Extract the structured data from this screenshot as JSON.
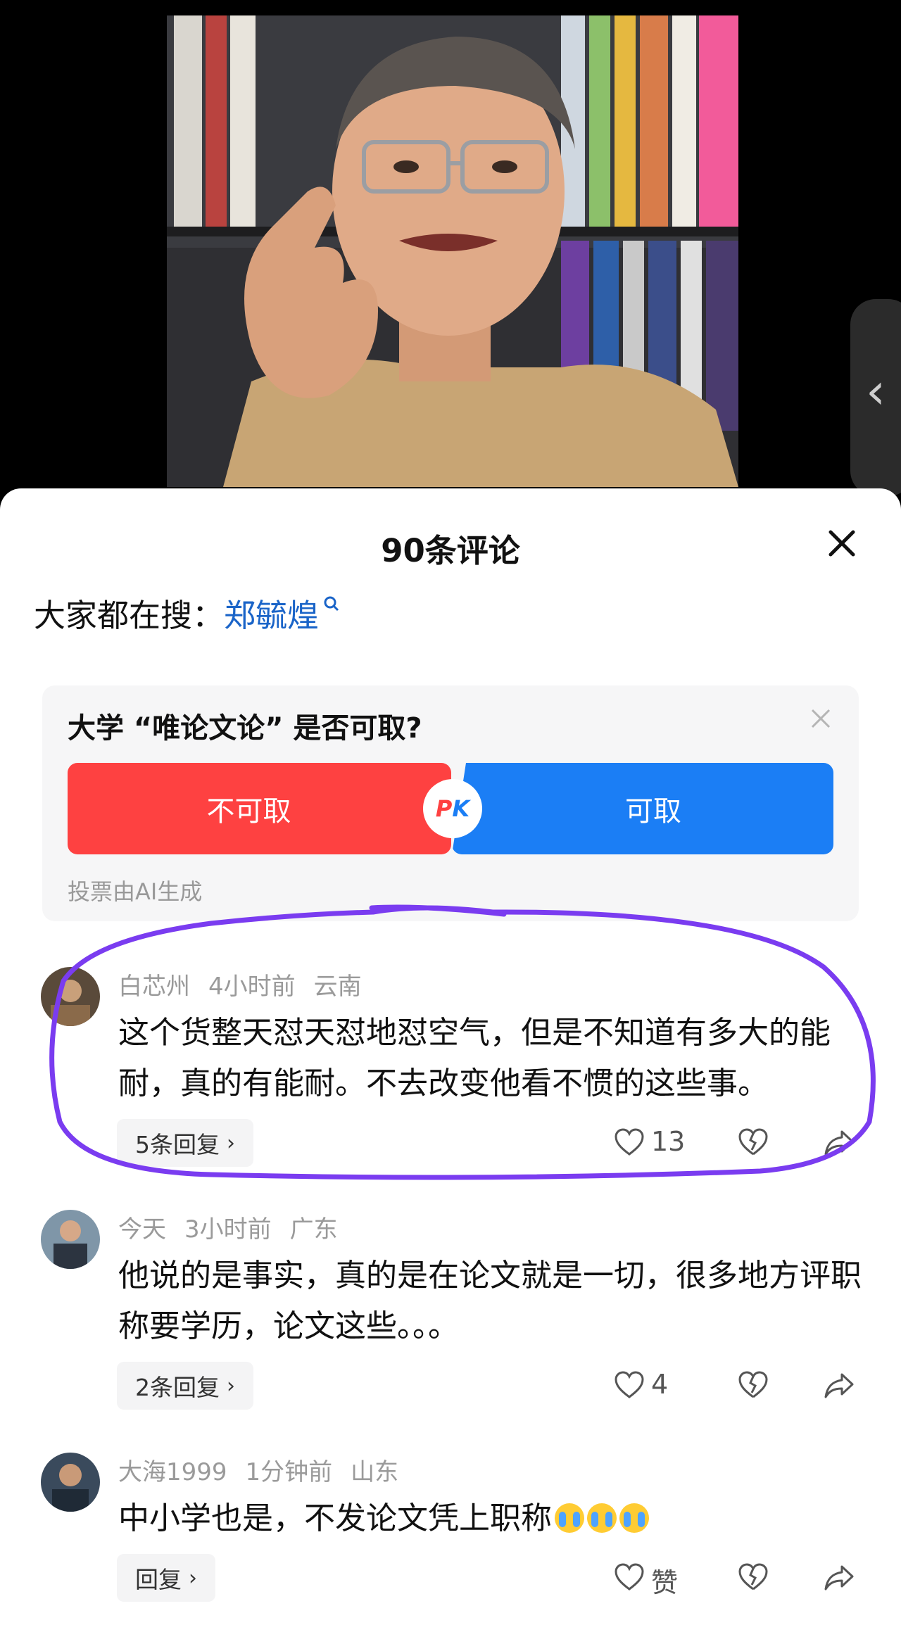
{
  "header": {
    "title": "90条评论"
  },
  "search": {
    "prefix": "大家都在搜：",
    "term": "郑毓煌"
  },
  "poll": {
    "question": "大学 “唯论文论” 是否可取?",
    "option_no": "不可取",
    "option_yes": "可取",
    "pk_p": "P",
    "pk_k": "K",
    "note": "投票由AI生成"
  },
  "comments": [
    {
      "user": "白芯州",
      "time": "4小时前",
      "location": "云南",
      "text": "这个货整天怼天怼地怼空气，但是不知道有多大的能耐，真的有能耐。不去改变他看不惯的这些事。",
      "replies": "5条回复",
      "likes": "13"
    },
    {
      "user": "今天",
      "time": "3小时前",
      "location": "广东",
      "text": "他说的是事实，真的是在论文就是一切，很多地方评职称要学历，论文这些。。。",
      "replies": "2条回复",
      "likes": "4"
    },
    {
      "user": "大海1999",
      "time": "1分钟前",
      "location": "山东",
      "text": "中小学也是，不发论文凭上职称",
      "replies": "回复",
      "likes": "赞"
    }
  ],
  "icons": {
    "close": "close-icon",
    "search": "search-icon",
    "like": "heart-icon",
    "dislike": "broken-heart-icon",
    "share": "share-icon",
    "back": "chevron-left-icon"
  },
  "colors": {
    "accent_red": "#fe4141",
    "accent_blue": "#1b7ef5",
    "link": "#1a64c8",
    "highlight": "#7a3cf0"
  }
}
